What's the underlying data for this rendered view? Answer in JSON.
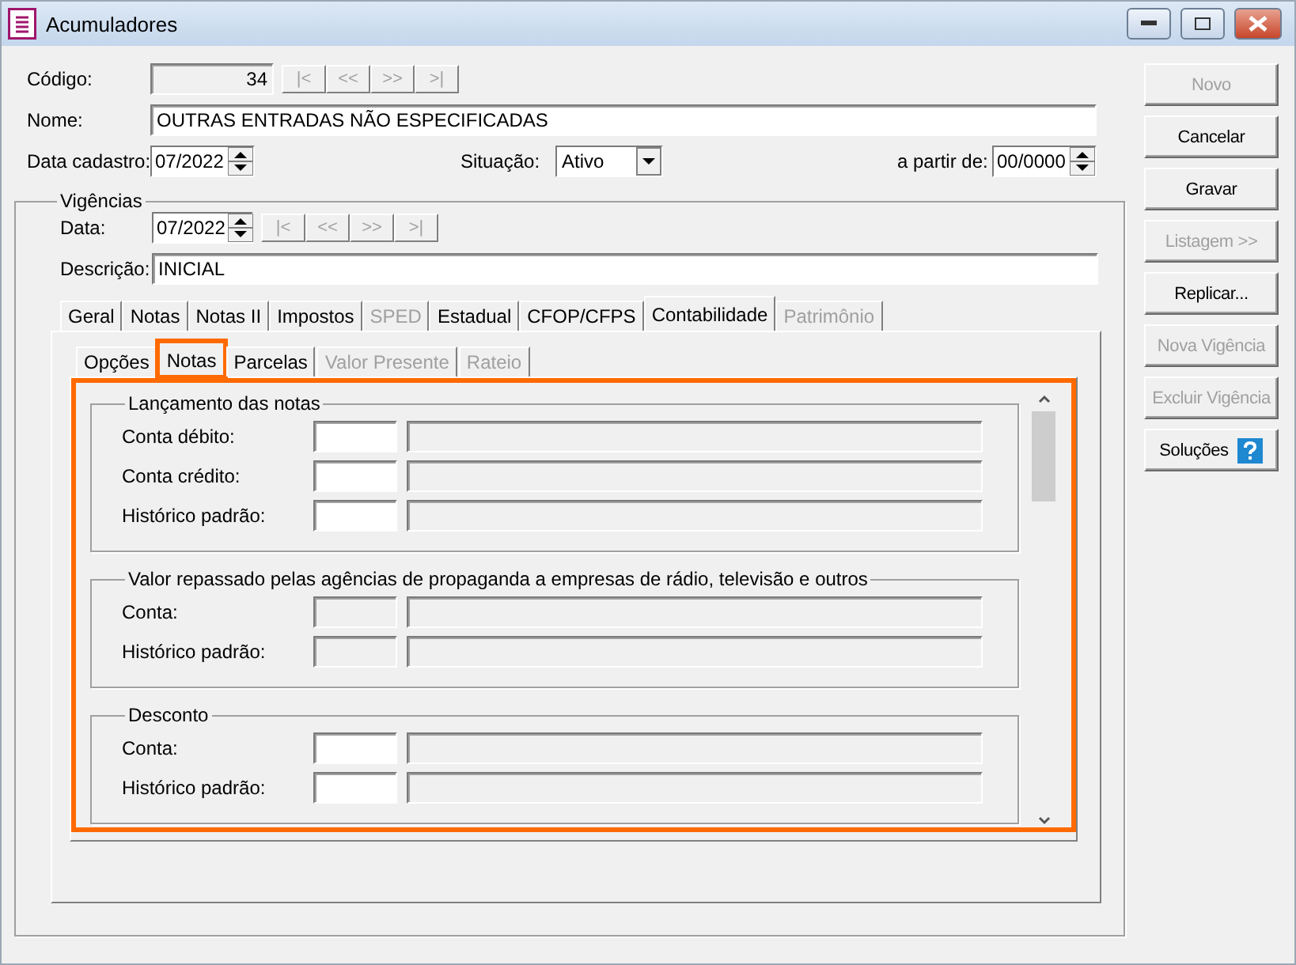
{
  "window": {
    "title": "Acumuladores"
  },
  "header": {
    "code": {
      "label": "Código:",
      "value": "34"
    },
    "code_nav": [
      {
        "label": "|<",
        "disabled": true
      },
      {
        "label": "<<",
        "disabled": true
      },
      {
        "label": ">>",
        "disabled": true
      },
      {
        "label": ">|",
        "disabled": true
      }
    ],
    "name": {
      "label": "Nome:",
      "value": "OUTRAS ENTRADAS NÃO ESPECIFICADAS"
    },
    "date": {
      "label": "Data cadastro:",
      "value": "07/2022"
    },
    "status": {
      "label": "Situação:",
      "value": "Ativo"
    },
    "from": {
      "label": "a partir de:",
      "value": "00/0000"
    }
  },
  "validity": {
    "title": "Vigências",
    "date": {
      "label": "Data:",
      "value": "07/2022"
    },
    "nav": [
      {
        "label": "|<",
        "disabled": true
      },
      {
        "label": "<<",
        "disabled": true
      },
      {
        "label": ">>",
        "disabled": true
      },
      {
        "label": ">|",
        "disabled": true
      }
    ],
    "description": {
      "label": "Descrição:",
      "value": "INICIAL"
    },
    "tabs": [
      {
        "label": "Geral",
        "selected": false,
        "disabled": false
      },
      {
        "label": "Notas",
        "selected": false,
        "disabled": false
      },
      {
        "label": "Notas II",
        "selected": false,
        "disabled": false
      },
      {
        "label": "Impostos",
        "selected": false,
        "disabled": false
      },
      {
        "label": "SPED",
        "selected": false,
        "disabled": true
      },
      {
        "label": "Estadual",
        "selected": false,
        "disabled": false
      },
      {
        "label": "CFOP/CFPS",
        "selected": false,
        "disabled": false
      },
      {
        "label": "Contabilidade",
        "selected": true,
        "disabled": false
      },
      {
        "label": "Patrimônio",
        "selected": false,
        "disabled": true
      }
    ],
    "subtabs": [
      {
        "label": "Opções",
        "selected": false,
        "disabled": false,
        "highlighted": false
      },
      {
        "label": "Notas",
        "selected": true,
        "disabled": false,
        "highlighted": true
      },
      {
        "label": "Parcelas",
        "selected": false,
        "disabled": false,
        "highlighted": false
      },
      {
        "label": "Valor Presente",
        "selected": false,
        "disabled": true,
        "highlighted": false
      },
      {
        "label": "Rateio",
        "selected": false,
        "disabled": true,
        "highlighted": false
      }
    ],
    "panel": {
      "highlighted": true,
      "groups": [
        {
          "title": "Lançamento das notas",
          "rows": [
            {
              "label": "Conta débito:",
              "disabled": false
            },
            {
              "label": "Conta crédito:",
              "disabled": false
            },
            {
              "label": "Histórico padrão:",
              "disabled": false
            }
          ]
        },
        {
          "title": "Valor repassado pelas agências de propaganda a empresas de rádio, televisão e outros",
          "rows": [
            {
              "label": "Conta:",
              "disabled": true
            },
            {
              "label": "Histórico padrão:",
              "disabled": true
            }
          ]
        },
        {
          "title": "Desconto",
          "rows": [
            {
              "label": "Conta:",
              "disabled": false
            },
            {
              "label": "Histórico padrão:",
              "disabled": false
            }
          ]
        }
      ]
    }
  },
  "actions": [
    {
      "label": "Novo",
      "disabled": true,
      "kind": "plain"
    },
    {
      "label": "Cancelar",
      "disabled": false,
      "kind": "plain"
    },
    {
      "label": "Gravar",
      "disabled": false,
      "kind": "plain"
    },
    {
      "label": "Listagem >>",
      "disabled": true,
      "kind": "plain"
    },
    {
      "label": "Replicar...",
      "disabled": false,
      "kind": "plain"
    },
    {
      "label": "Nova Vigência",
      "disabled": true,
      "kind": "plain"
    },
    {
      "label": "Excluir Vigência",
      "disabled": true,
      "kind": "plain"
    },
    {
      "label": "Soluções",
      "disabled": false,
      "kind": "help"
    }
  ]
}
